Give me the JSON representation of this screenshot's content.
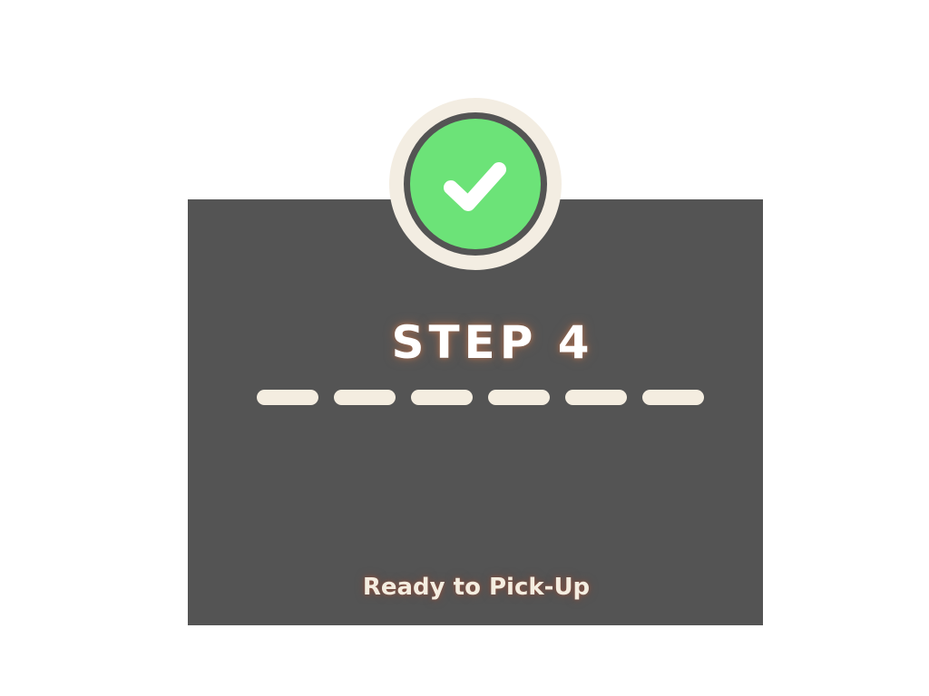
{
  "step": {
    "title": "STEP 4",
    "status": "Ready to Pick-Up",
    "completed_icon": "check-icon",
    "dash_count": 6
  },
  "colors": {
    "card_background": "#545454",
    "badge_ring": "#f3ede2",
    "check_green": "#6ce378",
    "check_mark": "#ffffff",
    "dash": "#f4ede0",
    "title_glow": "#a36b4f"
  }
}
